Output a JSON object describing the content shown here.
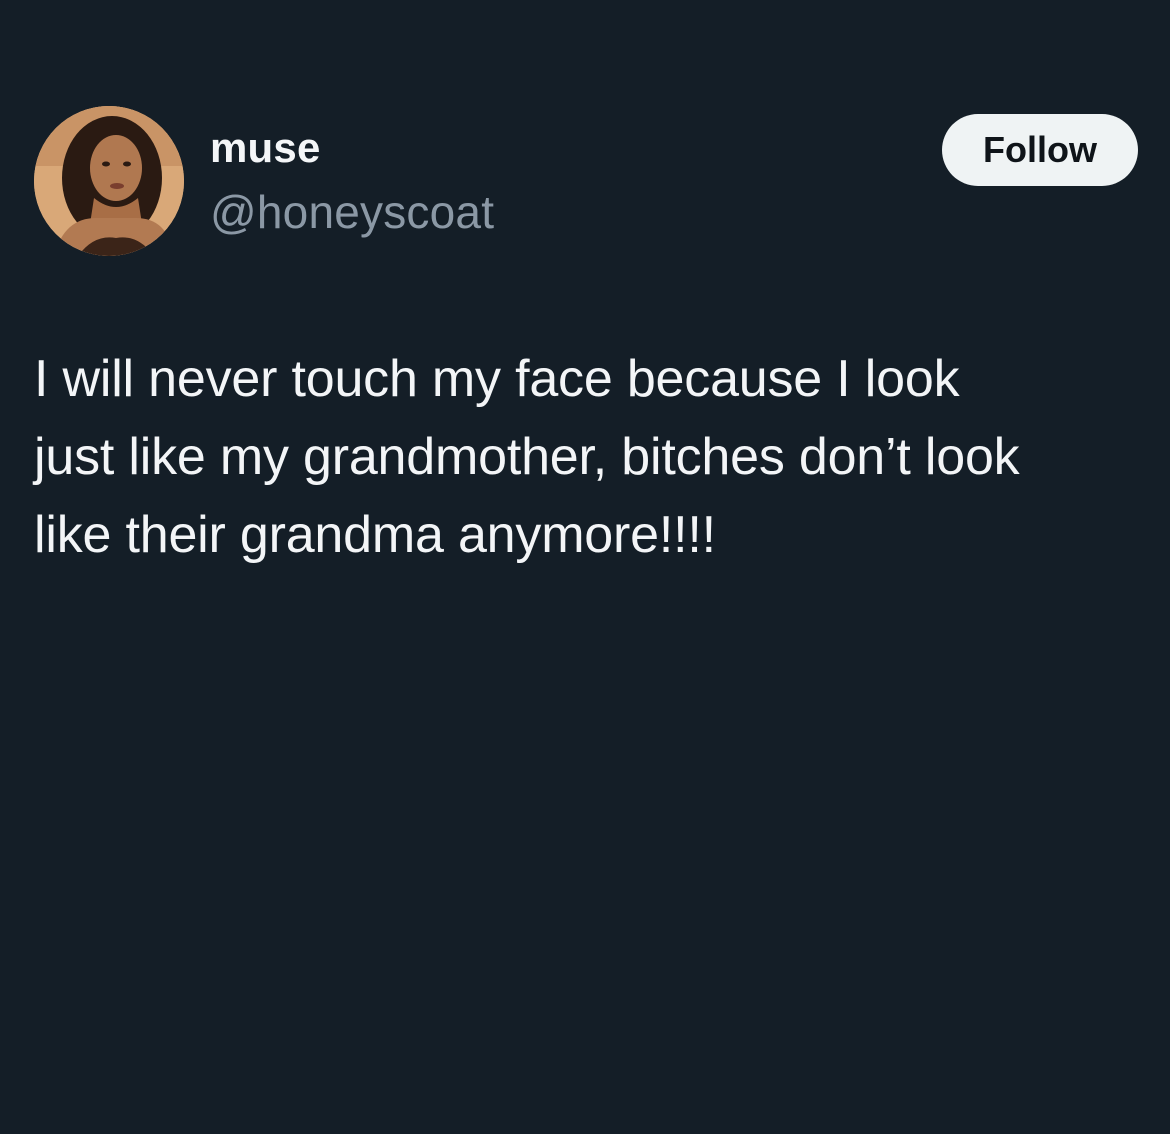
{
  "tweet": {
    "author": {
      "display_name": "muse",
      "handle": "@honeyscoat",
      "avatar_icon": "profile-photo-avatar"
    },
    "follow_button_label": "Follow",
    "text": "I will never touch my face because I look\njust like my grandmother, bitches don’t look\nlike their grandma anymore!!!!"
  },
  "colors": {
    "background": "#141e27",
    "text_primary": "#f3f5f7",
    "text_secondary": "#8b98a5",
    "button_bg": "#eff3f4",
    "button_text": "#0f1419"
  }
}
